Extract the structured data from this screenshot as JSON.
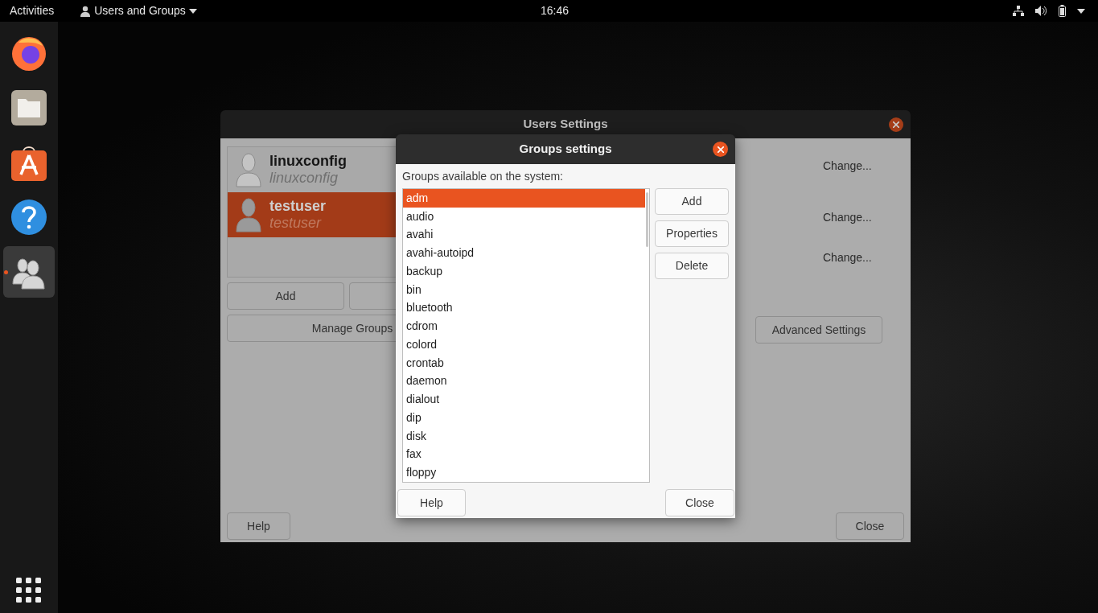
{
  "top_bar": {
    "activities": "Activities",
    "app_menu": "Users and Groups",
    "clock": "16:46"
  },
  "dock": {
    "items": [
      {
        "kind": "browser",
        "active": false
      },
      {
        "kind": "files",
        "active": false
      },
      {
        "kind": "software",
        "active": false
      },
      {
        "kind": "help",
        "active": false
      },
      {
        "kind": "users",
        "active": true
      }
    ]
  },
  "users_window": {
    "title": "Users Settings",
    "users": [
      {
        "name": "linuxconfig",
        "login": "linuxconfig",
        "selected": false
      },
      {
        "name": "testuser",
        "login": "testuser",
        "selected": true
      }
    ],
    "add_button": "Add",
    "manage_groups": "Manage Groups",
    "change_links": [
      "Change...",
      "Change...",
      "Change..."
    ],
    "advanced_settings": "Advanced Settings",
    "help": "Help",
    "close": "Close"
  },
  "groups_dialog": {
    "title": "Groups settings",
    "label": "Groups available on the system:",
    "groups": [
      {
        "name": "adm",
        "selected": true
      },
      {
        "name": "audio",
        "selected": false
      },
      {
        "name": "avahi",
        "selected": false
      },
      {
        "name": "avahi-autoipd",
        "selected": false
      },
      {
        "name": "backup",
        "selected": false
      },
      {
        "name": "bin",
        "selected": false
      },
      {
        "name": "bluetooth",
        "selected": false
      },
      {
        "name": "cdrom",
        "selected": false
      },
      {
        "name": "colord",
        "selected": false
      },
      {
        "name": "crontab",
        "selected": false
      },
      {
        "name": "daemon",
        "selected": false
      },
      {
        "name": "dialout",
        "selected": false
      },
      {
        "name": "dip",
        "selected": false
      },
      {
        "name": "disk",
        "selected": false
      },
      {
        "name": "fax",
        "selected": false
      },
      {
        "name": "floppy",
        "selected": false
      }
    ],
    "buttons": [
      "Add",
      "Properties",
      "Delete"
    ],
    "help": "Help",
    "close": "Close"
  }
}
